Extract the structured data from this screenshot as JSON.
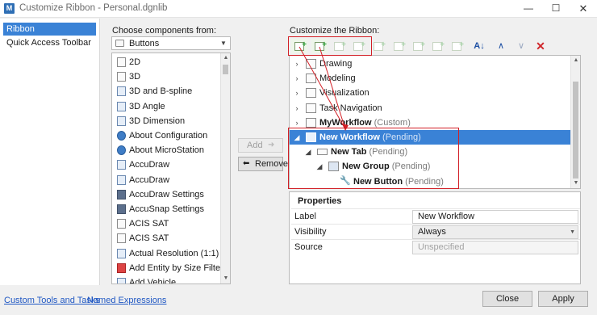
{
  "window": {
    "title": "Customize Ribbon - Personal.dgnlib",
    "app_icon": "M",
    "controls": {
      "minimize": "—",
      "maximize": "☐",
      "close": "✕"
    }
  },
  "nav": {
    "items": [
      {
        "label": "Ribbon",
        "selected": true
      },
      {
        "label": "Quick Access Toolbar",
        "selected": false
      }
    ]
  },
  "left": {
    "label": "Choose components from:",
    "dropdown": {
      "value": "Buttons"
    },
    "items": [
      {
        "label": "2D",
        "icon": "page-icon"
      },
      {
        "label": "3D",
        "icon": "page-icon"
      },
      {
        "label": "3D and B-spline",
        "icon": "bspline-icon"
      },
      {
        "label": "3D Angle",
        "icon": "angle-icon"
      },
      {
        "label": "3D Dimension",
        "icon": "dimension-icon"
      },
      {
        "label": "About Configuration",
        "icon": "info-icon"
      },
      {
        "label": "About MicroStation",
        "icon": "info-icon"
      },
      {
        "label": "AccuDraw",
        "icon": "accudraw-icon"
      },
      {
        "label": "AccuDraw",
        "icon": "accudraw-icon"
      },
      {
        "label": "AccuDraw Settings",
        "icon": "settings-icon"
      },
      {
        "label": "AccuSnap Settings",
        "icon": "snap-icon"
      },
      {
        "label": "ACIS SAT",
        "icon": "page-icon"
      },
      {
        "label": "ACIS SAT",
        "icon": "page-icon"
      },
      {
        "label": "Actual Resolution (1:1)",
        "icon": "resolution-icon"
      },
      {
        "label": "Add Entity by Size Filter",
        "icon": "filter-icon"
      },
      {
        "label": "Add Vehicle",
        "icon": "vehicle-icon"
      }
    ]
  },
  "middle": {
    "add_label": "Add",
    "add_glyph": "➜",
    "remove_label": "Remove",
    "remove_glyph": "⬅"
  },
  "right": {
    "label": "Customize the Ribbon:",
    "toolbar": {
      "sort_glyph": "A↓",
      "up_glyph": "∧",
      "down_glyph": "∨",
      "delete_glyph": "✕"
    },
    "tree": [
      {
        "label": "Drawing",
        "suffix": "",
        "indent": 0,
        "expander": "›",
        "icon": "page",
        "bold": false,
        "selected": false
      },
      {
        "label": "Modeling",
        "suffix": "",
        "indent": 0,
        "expander": "›",
        "icon": "page",
        "bold": false,
        "selected": false
      },
      {
        "label": "Visualization",
        "suffix": "",
        "indent": 0,
        "expander": "›",
        "icon": "page",
        "bold": false,
        "selected": false
      },
      {
        "label": "Task Navigation",
        "suffix": "",
        "indent": 0,
        "expander": "›",
        "icon": "page",
        "bold": false,
        "selected": false
      },
      {
        "label": "MyWorkflow",
        "suffix": "(Custom)",
        "indent": 0,
        "expander": "›",
        "icon": "page",
        "bold": true,
        "selected": false
      },
      {
        "label": "New Workflow",
        "suffix": "(Pending)",
        "indent": 0,
        "expander": "◢",
        "icon": "page",
        "bold": true,
        "selected": true
      },
      {
        "label": "New Tab",
        "suffix": "(Pending)",
        "indent": 1,
        "expander": "◢",
        "icon": "tab",
        "bold": true,
        "selected": false
      },
      {
        "label": "New Group",
        "suffix": "(Pending)",
        "indent": 2,
        "expander": "◢",
        "icon": "grp",
        "bold": true,
        "selected": false
      },
      {
        "label": "New Button",
        "suffix": "(Pending)",
        "indent": 3,
        "expander": "",
        "icon": "wrench",
        "bold": true,
        "selected": false
      }
    ],
    "properties": {
      "heading": "Properties",
      "rows": [
        {
          "label": "Label",
          "value": "New Workflow",
          "kind": "text"
        },
        {
          "label": "Visibility",
          "value": "Always",
          "kind": "combo"
        },
        {
          "label": "Source",
          "value": "Unspecified",
          "kind": "disabled"
        }
      ]
    }
  },
  "footer": {
    "link1": "Custom Tools and Tasks",
    "link2": "Named Expressions",
    "close": "Close",
    "apply": "Apply"
  },
  "annotation_color": "#d21f26"
}
